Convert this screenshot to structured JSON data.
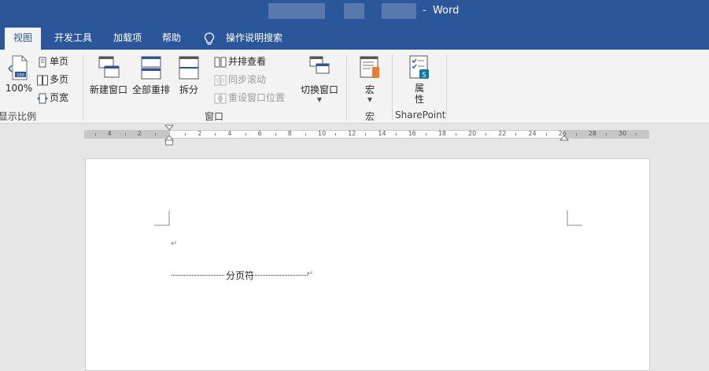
{
  "title": {
    "app": "Word",
    "separator": "-"
  },
  "tabs": [
    {
      "label": "视图",
      "active": true
    },
    {
      "label": "开发工具"
    },
    {
      "label": "加载项"
    },
    {
      "label": "帮助"
    },
    {
      "label": "操作说明搜索"
    }
  ],
  "ribbon": {
    "zoom": {
      "percent_label": "100%",
      "single_page": "单页",
      "multi_page": "多页",
      "page_width": "页宽",
      "group_label": "显示比例"
    },
    "window": {
      "new_window": "新建窗口",
      "arrange_all": "全部重排",
      "split": "拆分",
      "side_by_side": "并排查看",
      "sync_scroll": "同步滚动",
      "reset_position": "重设窗口位置",
      "switch_windows": "切换窗口",
      "group_label": "窗口"
    },
    "macros": {
      "macros": "宏",
      "group_label": "宏"
    },
    "sharepoint": {
      "properties_line1": "属",
      "properties_line2": "性",
      "group_label": "SharePoint"
    }
  },
  "ruler": {
    "left_labels": [
      "4",
      "2"
    ],
    "right_labels": [
      "2",
      "4",
      "6",
      "8",
      "10",
      "12",
      "14",
      "16",
      "18",
      "20",
      "22",
      "24",
      "26",
      "28",
      "30"
    ]
  },
  "document": {
    "paragraph_mark": "↵",
    "page_break_label": "分页符"
  },
  "colors": {
    "accent": "#2b579a",
    "ribbon_bg": "#f3f3f3",
    "canvas_bg": "#e6e6e6"
  }
}
